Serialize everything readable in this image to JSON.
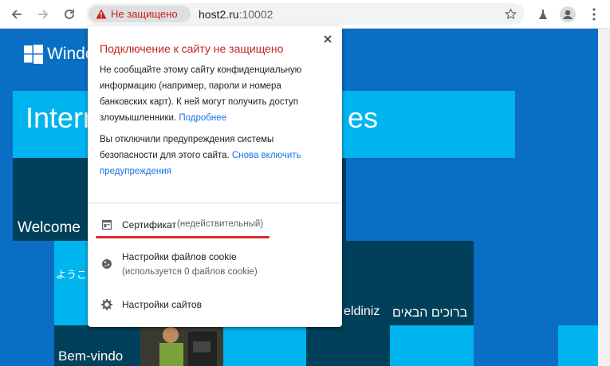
{
  "browser": {
    "security_chip": "Не защищено",
    "url_host": "host2.ru",
    "url_port": ":10002"
  },
  "iis": {
    "logo_text": "Windo",
    "banner_start": "Intern",
    "banner_end": "es",
    "tiles": {
      "welcome": "Welcome",
      "japanese": "ようこ",
      "turkish": "eldiniz",
      "hebrew": "ברוכים הבאים",
      "portuguese": "Bem-vindo"
    }
  },
  "popup": {
    "title": "Подключение к сайту не защищено",
    "para1": "Не сообщайте этому сайту конфиденциальную информацию (например, пароли и номера банковских карт). К ней могут получить доступ злоумышленники.",
    "para1_link": "Подробнее",
    "para2": "Вы отключили предупреждения системы безопасности для этого сайта.",
    "para2_link": "Снова включить предупреждения",
    "certificate_label": "Сертификат",
    "certificate_status": "(недействительный)",
    "cookies_label": "Настройки файлов cookie",
    "cookies_sub": "(используется 0 файлов cookie)",
    "site_settings_label": "Настройки сайтов"
  },
  "colors": {
    "warning_red": "#c5221f",
    "link_blue": "#1a73e8",
    "iis_blue": "#0a6ec4",
    "iis_cyan": "#00b4f0",
    "iis_dark": "#00405a"
  }
}
